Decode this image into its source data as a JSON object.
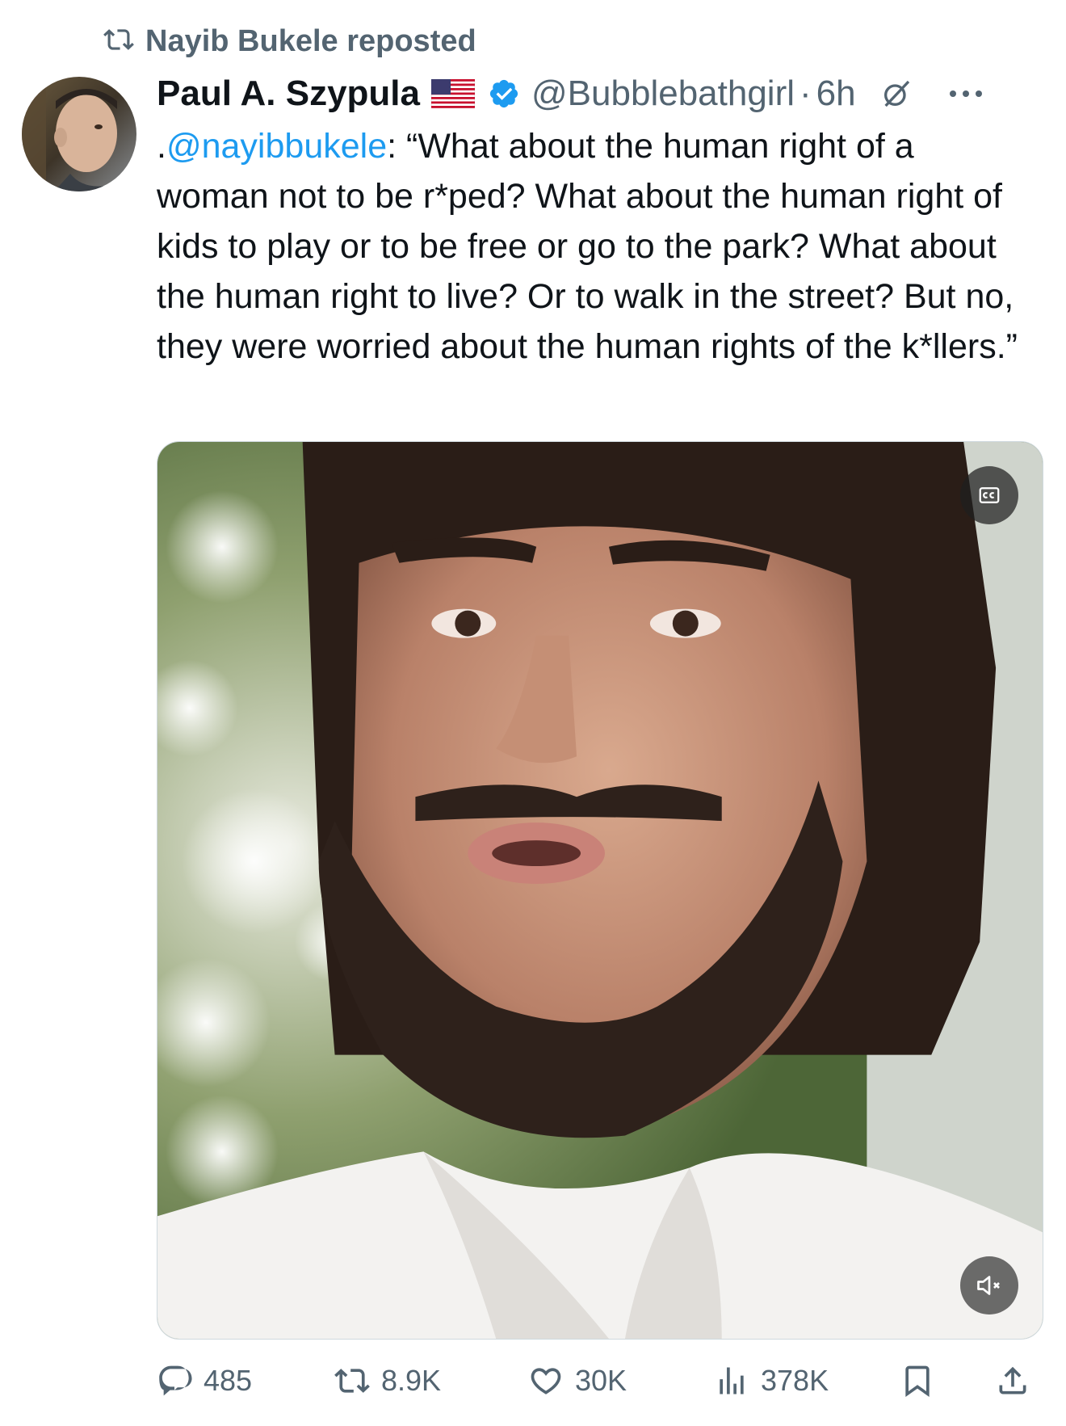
{
  "repost": {
    "text": "Nayib Bukele reposted"
  },
  "tweet": {
    "author": {
      "display_name": "Paul A. Szypula",
      "handle": "@Bubblebathgirl",
      "separator": "·",
      "time": "6h"
    },
    "text": {
      "prefix": ".",
      "mention": "@nayibbukele",
      "body": ": “What about the human right of a woman not to be r*ped? What about the human right of kids to play or to be free or go to the park? What about the human right to live? Or to walk in the street? But no, they were worried about the human rights of the k*llers.”"
    },
    "media": {
      "type": "video",
      "captions_control": "cc-icon",
      "sound_control": "muted-speaker-icon"
    },
    "stats": {
      "replies": "485",
      "reposts": "8.9K",
      "likes": "30K",
      "views": "378K"
    }
  },
  "colors": {
    "text_primary": "#0f1419",
    "text_secondary": "#536471",
    "link": "#1d9bf0",
    "verified": "#1d9bf0"
  }
}
